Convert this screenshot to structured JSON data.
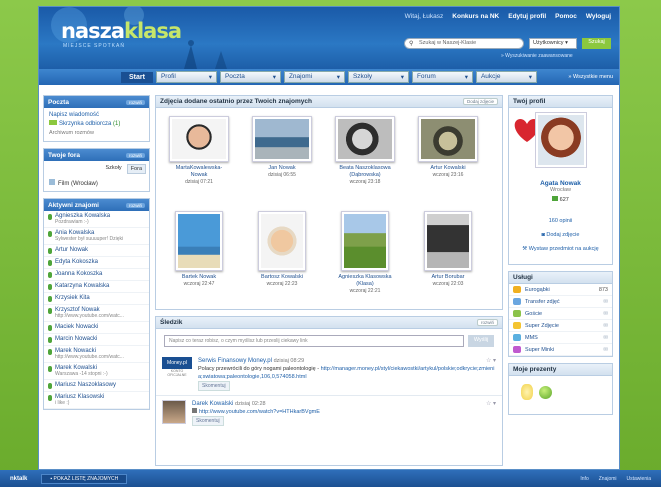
{
  "site": {
    "logo_main": "nasza",
    "logo_accent": "klasa",
    "tagline": "MIEJSCE SPOTKAŃ"
  },
  "toplinks": {
    "greeting": "Witaj, Łukasz",
    "items": [
      "Konkurs na NK",
      "Edytuj profil",
      "Pomoc",
      "Wyloguj"
    ]
  },
  "search": {
    "placeholder": "Szukaj w Naszej-Klasie",
    "scope": "Użytkownicy",
    "button": "Szukaj",
    "advanced": "» Wyszukiwanie zaawansowane"
  },
  "nav": {
    "start": "Start",
    "items": [
      "Profil",
      "Poczta",
      "Znajomi",
      "Szkoły",
      "Forum",
      "Aukcje"
    ],
    "more": "» Wszystkie menu"
  },
  "left": {
    "poczta": {
      "title": "Poczta",
      "option": "rozwiń",
      "links": [
        "Napisz wiadomość",
        "Skrzynka odbiorcza",
        "Archiwum rozmów"
      ],
      "inbox_count": "(1)"
    },
    "fora": {
      "title": "Twoje fora",
      "option": "rozwiń",
      "tabs": [
        "Szkoły",
        "Fora"
      ],
      "item": "Film (Wrocław)"
    },
    "friends": {
      "title": "Aktywni znajomi",
      "option": "rozwiń",
      "items": [
        {
          "name": "Agnieszka Kowalska",
          "status": "Pozdrawiam :-)"
        },
        {
          "name": "Ania Kowalska",
          "status": "Sylwester był suuuuper! Dzięki"
        },
        {
          "name": "Artur Nowak",
          "status": ""
        },
        {
          "name": "Edyta Kokoszka",
          "status": ""
        },
        {
          "name": "Joanna Kokoszka",
          "status": ""
        },
        {
          "name": "Katarzyna Kowalska",
          "status": ""
        },
        {
          "name": "Krzysiek Kita",
          "status": ""
        },
        {
          "name": "Krzysztof Nowak",
          "status": "http://www.youtube.com/watc..."
        },
        {
          "name": "Maciek Nowacki",
          "status": ""
        },
        {
          "name": "Marcin Nowacki",
          "status": ""
        },
        {
          "name": "Marek Nowacki",
          "status": "http://www.youtube.com/watc..."
        },
        {
          "name": "Marek Kowalski",
          "status": "Warszawa -14 stopni :-)"
        },
        {
          "name": "Mariusz Naszoklasowy",
          "status": ""
        },
        {
          "name": "Mariusz Klasowski",
          "status": "i like :)"
        }
      ]
    }
  },
  "photos": {
    "title": "Zdjęcia dodane ostatnio przez Twoich znajomych",
    "option": "Dodaj zdjęcie",
    "items": [
      {
        "name": "MartaKowalewska-Nowak",
        "date": "dzisiaj 07:21"
      },
      {
        "name": "Jan Nowak",
        "date": "dzisiaj 06:55"
      },
      {
        "name": "Beata Naszoklasowa (Dąbrowska)",
        "date": "wczoraj 23:18"
      },
      {
        "name": "Artur Kowalski",
        "date": "wczoraj 23:16"
      },
      {
        "name": "Bartek Nowak",
        "date": "wczoraj 22:47"
      },
      {
        "name": "Bartosz Kowalski",
        "date": "wczoraj 22:23"
      },
      {
        "name": "Agnieszka Klasowska (Klasa)",
        "date": "wczoraj 22:21"
      },
      {
        "name": "Artur Borubar",
        "date": "wczoraj 22:03"
      }
    ]
  },
  "sledzik": {
    "title": "Śledzik",
    "option": "rozwiń",
    "input_placeholder": "Napisz co teraz robisz, o czym myślisz lub przeslij ciekawy link",
    "button": "Wyślij",
    "posts": [
      {
        "author": "Serwis Finansowy Money.pl",
        "time": "dzisiaj 08:29",
        "avatar": "Money.pl",
        "avatar_sub": "KONTO OFICJALNE",
        "text": "Polacy przewrócili do góry nogami paleontologię -",
        "link": "http://manager.money.pl/styl/ciekawostki/artykul/polskie;odkrycie;zmienia;swiatowa;paleontologie,106,0,574058.html",
        "action": "Skomentuj"
      },
      {
        "author": "Darek Kowalski",
        "time": "dzisiaj 02:28",
        "link": "http://www.youtube.com/watch?v=HTHkarBVgmE",
        "action": "Skomentuj"
      }
    ]
  },
  "profile": {
    "title": "Twój profil",
    "name": "Agata Nowak",
    "city": "Wrocław",
    "gifts_count": "627",
    "views": "160 opinii",
    "add_photo": "Dodaj zdjęcie",
    "auction": "Wystaw przedmiot na aukcję"
  },
  "services": {
    "title": "Usługi",
    "items": [
      {
        "name": "Eurogąbki",
        "value": "873",
        "color": "#f0b020"
      },
      {
        "name": "Transfer zdjęć",
        "value": "",
        "color": "#6aa6e0"
      },
      {
        "name": "Goście",
        "value": "",
        "color": "#8bc34a"
      },
      {
        "name": "Super Zdjęcie",
        "value": "",
        "color": "#f4c430"
      },
      {
        "name": "MMS",
        "value": "",
        "color": "#5ab0e0"
      },
      {
        "name": "Super Minki",
        "value": "",
        "color": "#c05acf"
      }
    ]
  },
  "gifts": {
    "title": "Moje prezenty"
  },
  "bottom": {
    "app": "nktalk",
    "list": "POKAŻ LISTĘ ZNAJOMYCH",
    "right": [
      "Info",
      "Znajomi",
      "Ustawienia"
    ]
  }
}
